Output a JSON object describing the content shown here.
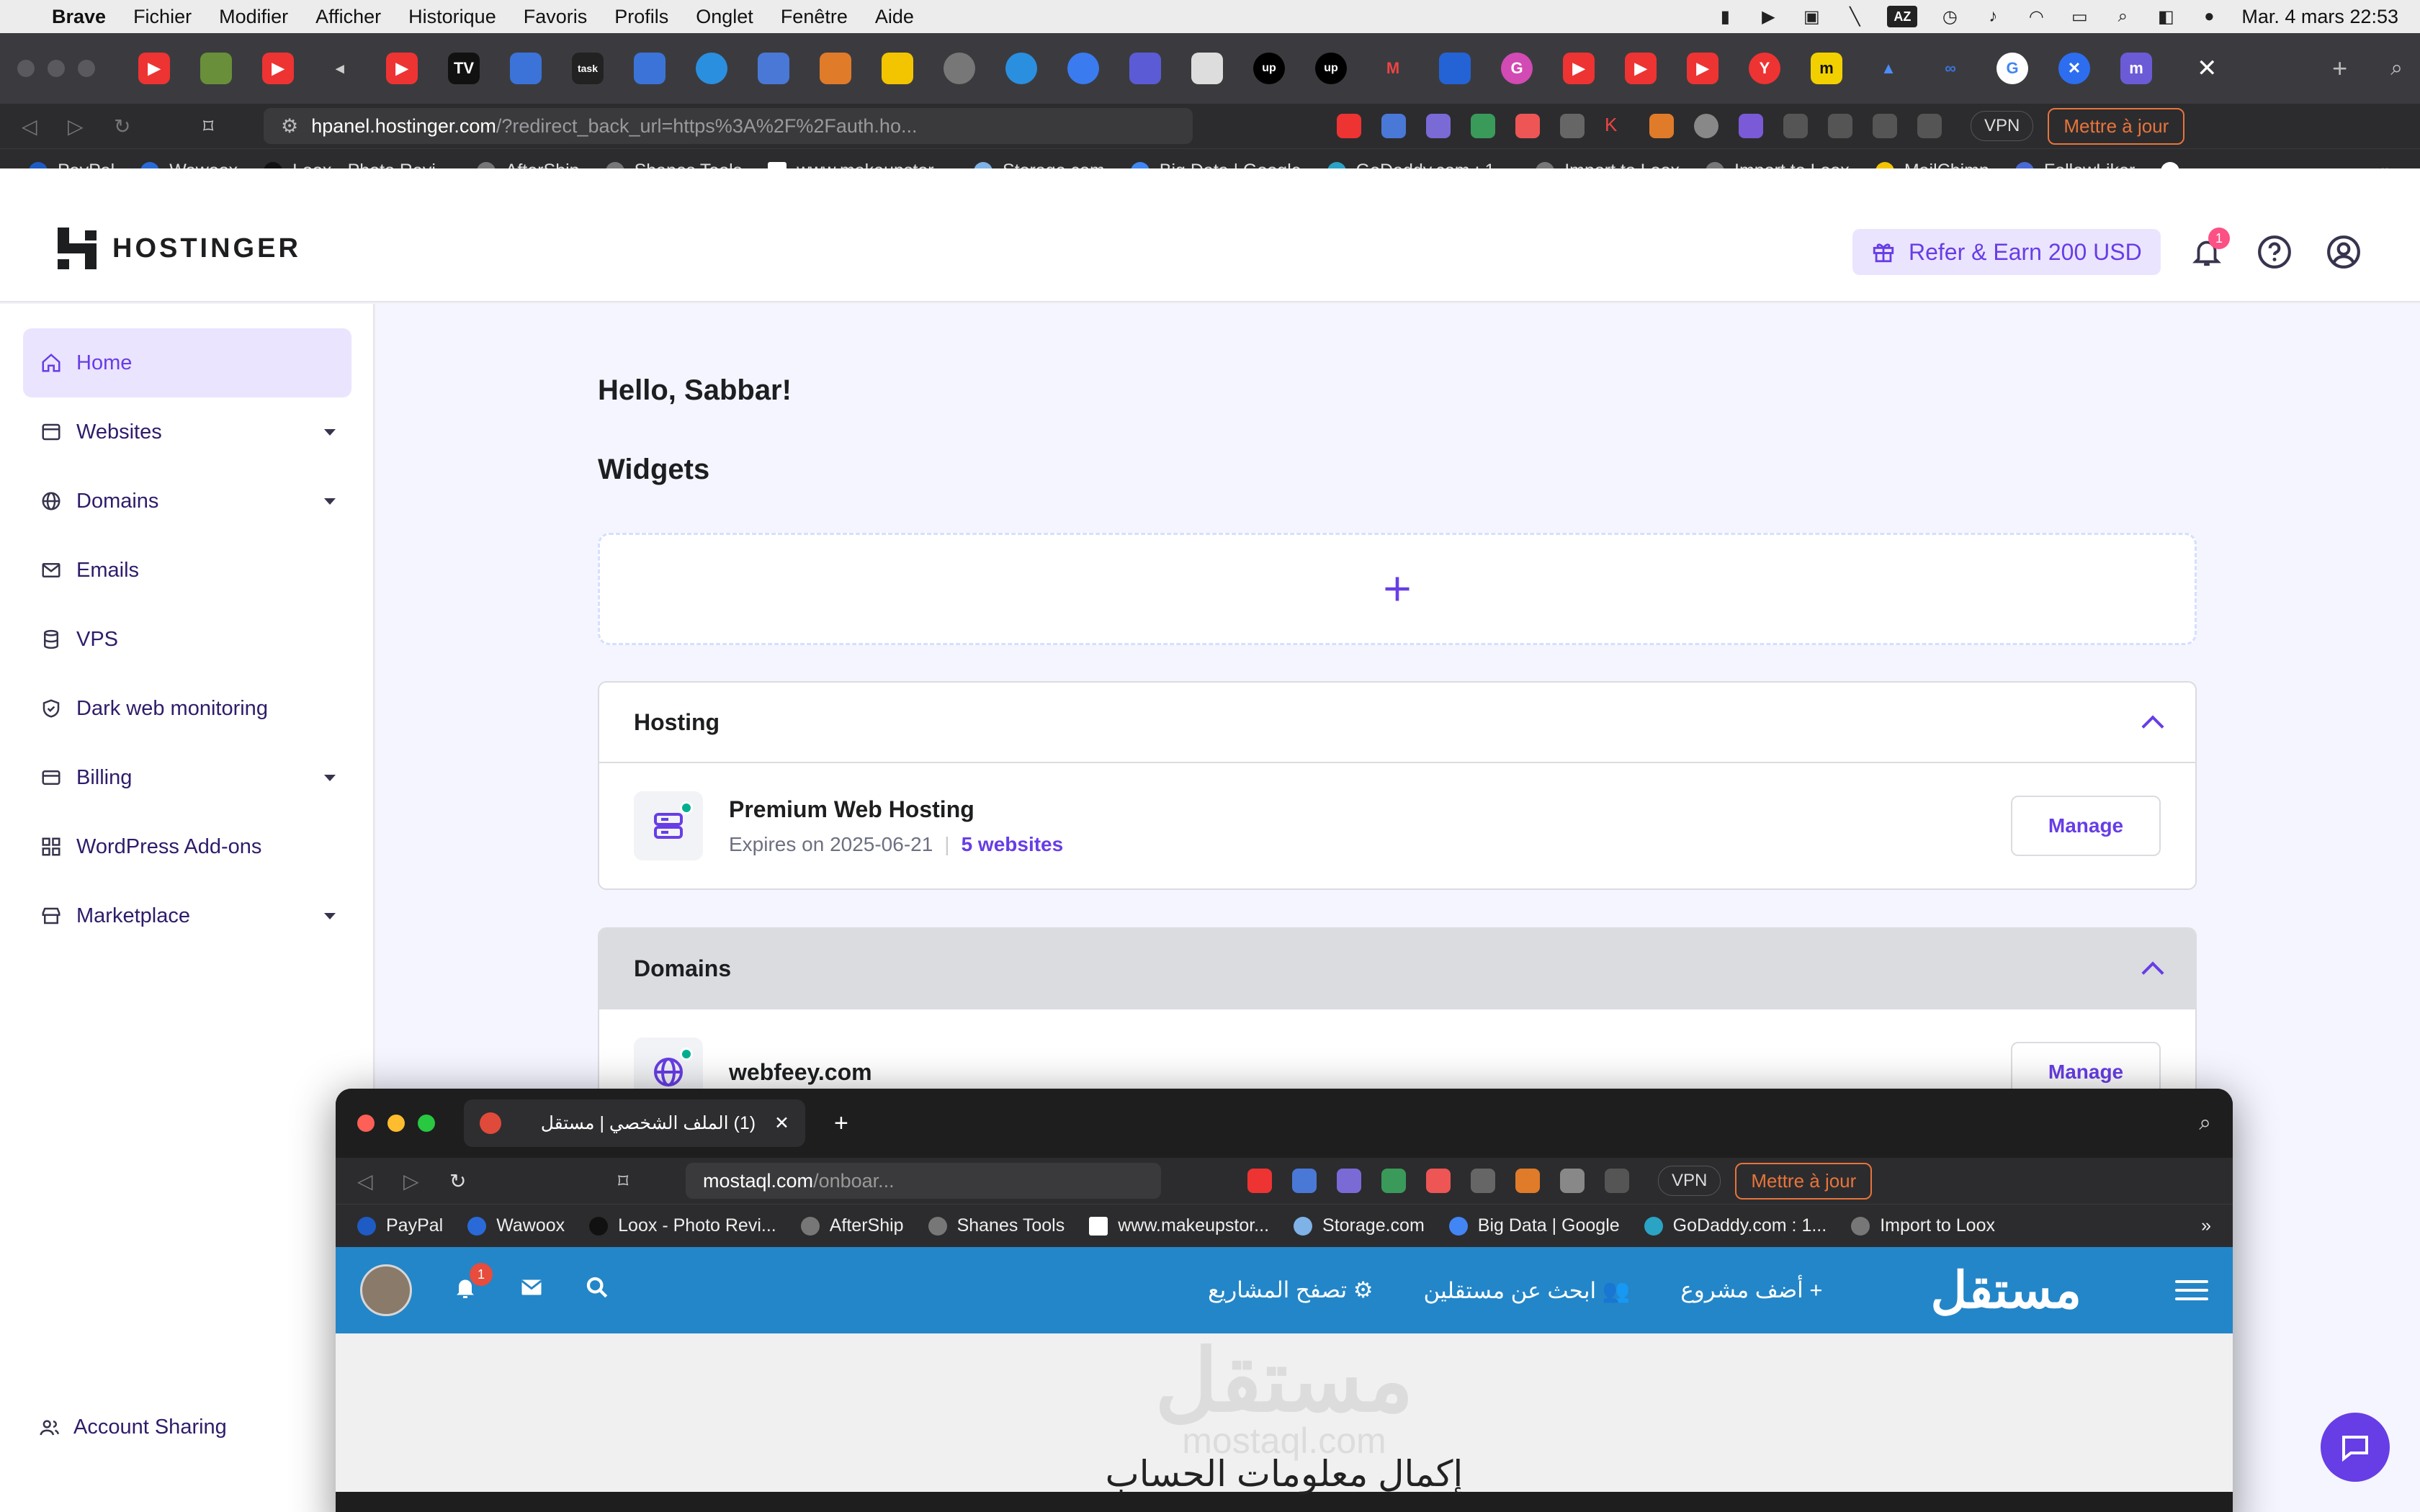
{
  "menubar": {
    "app": "Brave",
    "items": [
      "Fichier",
      "Modifier",
      "Afficher",
      "Historique",
      "Favoris",
      "Profils",
      "Onglet",
      "Fenêtre",
      "Aide"
    ],
    "az": "AZ",
    "datetime": "Mar. 4 mars  22:53"
  },
  "browser": {
    "url_host": "hpanel.hostinger.com",
    "url_path": "/?redirect_back_url=https%3A%2F%2Fauth.ho...",
    "vpn": "VPN",
    "update": "Mettre à jour",
    "bookmarks": [
      "PayPal",
      "Wawoox",
      "Loox - Photo Revi...",
      "AfterShip",
      "Shanes Tools",
      "www.makeupstor...",
      "Storage.com",
      "Big Data  |  Google",
      "GoDaddy.com : 1...",
      "Import to Loox",
      "Import to Loox",
      "MailChimp",
      "FollowLiker"
    ]
  },
  "header": {
    "logo": "HOSTINGER",
    "refer": "Refer & Earn 200 USD",
    "notifications": "1"
  },
  "sidebar": {
    "items": [
      {
        "label": "Home",
        "icon": "home-icon"
      },
      {
        "label": "Websites",
        "icon": "browser-icon"
      },
      {
        "label": "Domains",
        "icon": "globe-icon"
      },
      {
        "label": "Emails",
        "icon": "mail-icon"
      },
      {
        "label": "VPS",
        "icon": "database-icon"
      },
      {
        "label": "Dark web monitoring",
        "icon": "shield-icon"
      },
      {
        "label": "Billing",
        "icon": "card-icon"
      },
      {
        "label": "WordPress Add-ons",
        "icon": "grid-icon"
      },
      {
        "label": "Marketplace",
        "icon": "store-icon"
      }
    ],
    "account_sharing": "Account Sharing"
  },
  "main": {
    "greeting": "Hello, Sabbar!",
    "widgets": "Widgets",
    "hosting": {
      "title": "Hosting",
      "service": "Premium Web Hosting",
      "expires": "Expires on 2025-06-21",
      "websites": "5 websites",
      "manage": "Manage"
    },
    "domains": {
      "title": "Domains",
      "domain": "webfeey.com",
      "manage": "Manage"
    }
  },
  "window2": {
    "tab_title": "(1) الملف الشخصي | مستقل",
    "url_host": "mostaql.com",
    "url_path": "/onboar...",
    "vpn": "VPN",
    "update": "Mettre à jour",
    "bookmarks": [
      "PayPal",
      "Wawoox",
      "Loox - Photo Revi...",
      "AfterShip",
      "Shanes Tools",
      "www.makeupstor...",
      "Storage.com",
      "Big Data  |  Google",
      "GoDaddy.com : 1...",
      "Import to Loox"
    ],
    "nav": {
      "notif_count": "1",
      "browse_projects": "تصفح المشاريع",
      "find_freelancers": "ابحث عن مستقلين",
      "add_project": "أضف مشروع",
      "logo": "مستقل"
    },
    "watermark": "مستقل",
    "watermark_sub": "mostaql.com",
    "heading": "إكمال معلومات الحساب"
  }
}
